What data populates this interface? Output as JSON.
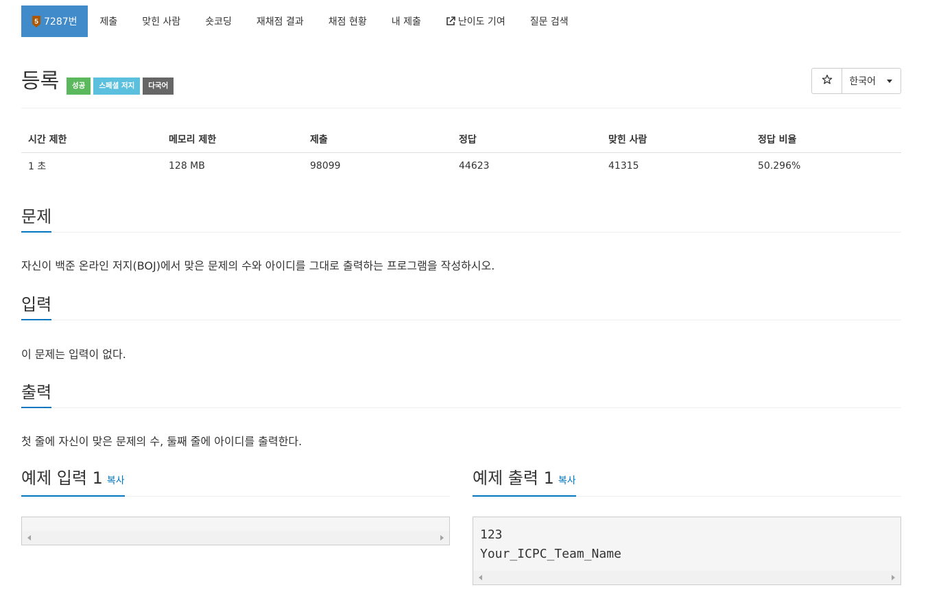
{
  "nav": {
    "tier_badge": "5",
    "problem_id_label": "7287번",
    "items": [
      "제출",
      "맞힌 사람",
      "숏코딩",
      "재채점 결과",
      "채점 현황",
      "내 제출",
      "난이도 기여",
      "질문 검색"
    ],
    "tier_color": "#ad5600",
    "active_color": "#428bca"
  },
  "title": {
    "text": "등록",
    "labels": [
      "성공",
      "스페셜 저지",
      "다국어"
    ],
    "star_icon": "star-outline-icon",
    "language": "한국어"
  },
  "info_table": {
    "headers": [
      "시간 제한",
      "메모리 제한",
      "제출",
      "정답",
      "맞힌 사람",
      "정답 비율"
    ],
    "row": [
      "1 초",
      "128 MB",
      "98099",
      "44623",
      "41315",
      "50.296%"
    ]
  },
  "sections": {
    "problem": {
      "heading": "문제",
      "text": "자신이 백준 온라인 저지(BOJ)에서 맞은 문제의 수와 아이디를 그대로 출력하는 프로그램을 작성하시오."
    },
    "input": {
      "heading": "입력",
      "text": "이 문제는 입력이 없다."
    },
    "output": {
      "heading": "출력",
      "text": "첫 줄에 자신이 맞은 문제의 수, 둘째 줄에 아이디를 출력한다."
    }
  },
  "samples": {
    "input": {
      "heading": "예제 입력 1",
      "copy": "복사",
      "content": ""
    },
    "output": {
      "heading": "예제 출력 1",
      "copy": "복사",
      "content": "123\nYour_ICPC_Team_Name"
    }
  }
}
